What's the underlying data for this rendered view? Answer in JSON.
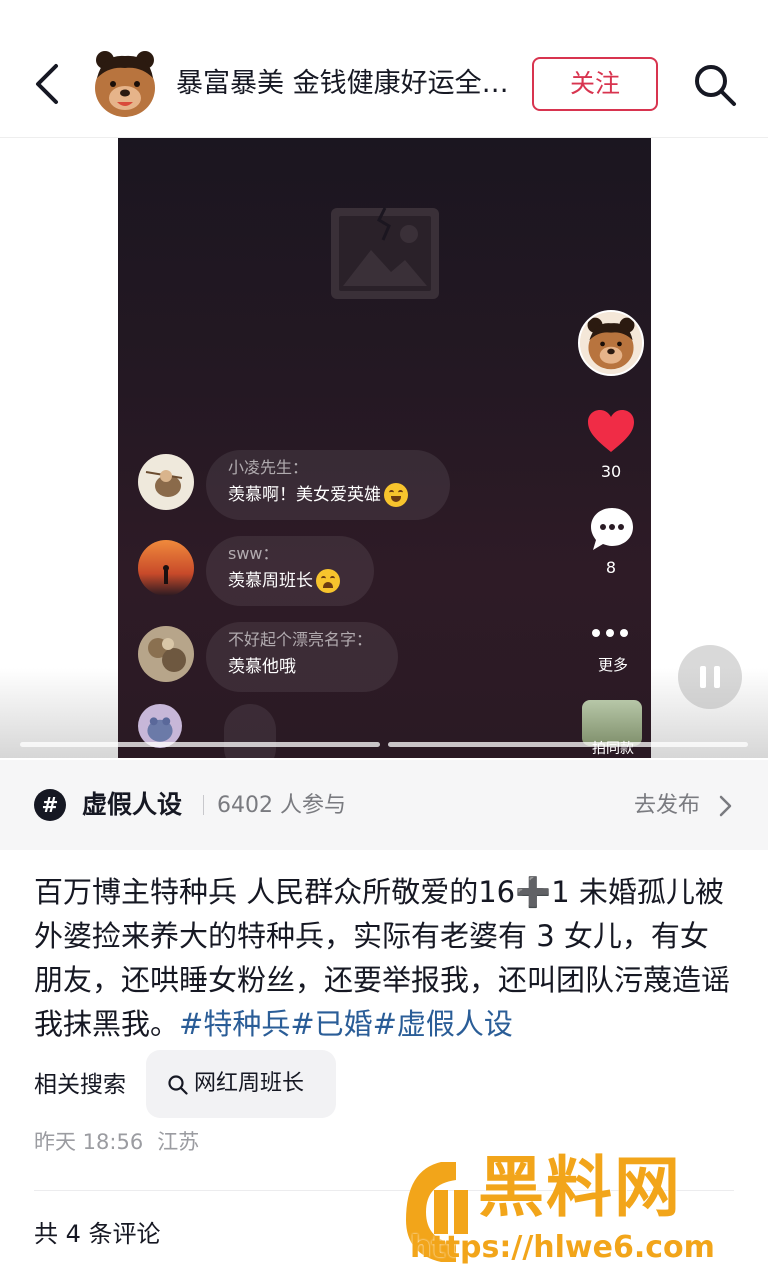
{
  "header": {
    "title": "暴富暴美 金钱健康好运全…",
    "follow_label": "关注"
  },
  "video": {
    "comments": [
      {
        "name": "小凌先生：",
        "text": "羡慕啊！美女爱英雄",
        "emoji": "laugh-cry-emoji"
      },
      {
        "name": "sww：",
        "text": "羡慕周班长",
        "emoji": "cry-emoji"
      },
      {
        "name": "不好起个漂亮名字：",
        "text": "羡慕他哦",
        "emoji": ""
      }
    ],
    "likes": "30",
    "comment_count": "8",
    "more_label": "更多",
    "same_label": "拍同款"
  },
  "topic": {
    "name": "虚假人设",
    "participants": "6402 人参与",
    "action": "去发布"
  },
  "description": {
    "body": "百万博主特种兵 人民群众所敬爱的16➕1 未婚孤儿被外婆捡来养大的特种兵，实际有老婆有 3 女儿，有女朋友，还哄睡女粉丝，还要举报我，还叫团队污蔑造谣我抹黑我。",
    "tags": "#特种兵#已婚#虚假人设"
  },
  "related": {
    "label": "相关搜索",
    "query": "网红周班长"
  },
  "meta": {
    "time": "昨天 18:56",
    "location": "江苏"
  },
  "comments_total": "共 4 条评论",
  "watermark": {
    "brand": "黑料网",
    "url": "https://hlwe6.com"
  },
  "colors": {
    "accent": "#d8344f",
    "hashtag": "#2a5d97",
    "watermark": "#f2a51a"
  }
}
